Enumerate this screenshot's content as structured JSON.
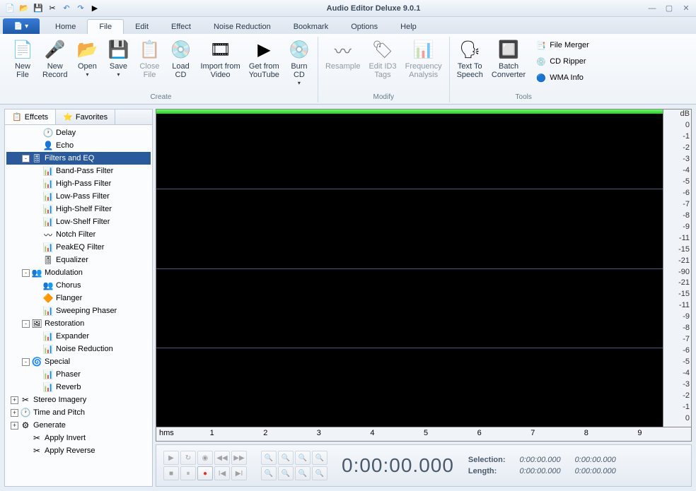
{
  "title": "Audio Editor Deluxe 9.0.1",
  "ribbon_tabs": [
    "Home",
    "File",
    "Edit",
    "Effect",
    "Noise Reduction",
    "Bookmark",
    "Options",
    "Help"
  ],
  "ribbon": {
    "create": {
      "label": "Create",
      "items": [
        {
          "label": "New\nFile",
          "icon": "📄"
        },
        {
          "label": "New\nRecord",
          "icon": "🎤"
        },
        {
          "label": "Open",
          "icon": "📂",
          "drop": true
        },
        {
          "label": "Save",
          "icon": "💾",
          "drop": true
        },
        {
          "label": "Close\nFile",
          "icon": "📋",
          "disabled": true
        },
        {
          "label": "Load\nCD",
          "icon": "💿"
        },
        {
          "label": "Import from\nVideo",
          "icon": "🎞"
        },
        {
          "label": "Get from\nYouTube",
          "icon": "▶"
        },
        {
          "label": "Burn\nCD",
          "icon": "💿",
          "drop": true
        }
      ]
    },
    "modify": {
      "label": "Modify",
      "items": [
        {
          "label": "Resample",
          "icon": "〰",
          "disabled": true
        },
        {
          "label": "Edit ID3\nTags",
          "icon": "🏷",
          "disabled": true
        },
        {
          "label": "Frequency\nAnalysis",
          "icon": "📊",
          "disabled": true
        }
      ]
    },
    "tools": {
      "label": "Tools",
      "items": [
        {
          "label": "Text To\nSpeech",
          "icon": "🗣"
        },
        {
          "label": "Batch\nConverter",
          "icon": "🔲"
        }
      ],
      "side": [
        {
          "label": "File Merger",
          "icon": "📑"
        },
        {
          "label": "CD Ripper",
          "icon": "💿"
        },
        {
          "label": "WMA Info",
          "icon": "🔵"
        }
      ]
    }
  },
  "side_tabs": {
    "effects": "Effcets",
    "favorites": "Favorites"
  },
  "tree": [
    {
      "indent": 2,
      "icon": "🕐",
      "label": "Delay"
    },
    {
      "indent": 2,
      "icon": "👤",
      "label": "Echo"
    },
    {
      "indent": 1,
      "toggle": "-",
      "icon": "🎚",
      "label": "Filters and EQ",
      "selected": true
    },
    {
      "indent": 2,
      "icon": "📊",
      "label": "Band-Pass Filter"
    },
    {
      "indent": 2,
      "icon": "📊",
      "label": "High-Pass Filter"
    },
    {
      "indent": 2,
      "icon": "📊",
      "label": "Low-Pass Filter"
    },
    {
      "indent": 2,
      "icon": "📊",
      "label": "High-Shelf Filter"
    },
    {
      "indent": 2,
      "icon": "📊",
      "label": "Low-Shelf Filter"
    },
    {
      "indent": 2,
      "icon": "〰",
      "label": "Notch Filter"
    },
    {
      "indent": 2,
      "icon": "📊",
      "label": "PeakEQ Filter"
    },
    {
      "indent": 2,
      "icon": "🎚",
      "label": "Equalizer"
    },
    {
      "indent": 1,
      "toggle": "-",
      "icon": "👥",
      "label": "Modulation"
    },
    {
      "indent": 2,
      "icon": "👥",
      "label": "Chorus"
    },
    {
      "indent": 2,
      "icon": "🔶",
      "label": "Flanger"
    },
    {
      "indent": 2,
      "icon": "📊",
      "label": "Sweeping Phaser"
    },
    {
      "indent": 1,
      "toggle": "-",
      "icon": "🖼",
      "label": "Restoration"
    },
    {
      "indent": 2,
      "icon": "📊",
      "label": "Expander"
    },
    {
      "indent": 2,
      "icon": "📊",
      "label": "Noise Reduction"
    },
    {
      "indent": 1,
      "toggle": "-",
      "icon": "🌀",
      "label": "Special"
    },
    {
      "indent": 2,
      "icon": "📊",
      "label": "Phaser"
    },
    {
      "indent": 2,
      "icon": "📊",
      "label": "Reverb"
    },
    {
      "indent": 0,
      "toggle": "+",
      "icon": "✂",
      "label": "Stereo Imagery"
    },
    {
      "indent": 0,
      "toggle": "+",
      "icon": "🕐",
      "label": "Time and Pitch"
    },
    {
      "indent": 0,
      "toggle": "+",
      "icon": "⚙",
      "label": "Generate"
    },
    {
      "indent": 1,
      "icon": "✂",
      "label": "Apply Invert"
    },
    {
      "indent": 1,
      "icon": "✂",
      "label": "Apply Reverse"
    }
  ],
  "db_scale": [
    "dB",
    "0",
    "-1",
    "-2",
    "-3",
    "-4",
    "-5",
    "-6",
    "-7",
    "-8",
    "-9",
    "-11",
    "-15",
    "-21",
    "-90",
    "-21",
    "-15",
    "-11",
    "-9",
    "-8",
    "-7",
    "-6",
    "-5",
    "-4",
    "-3",
    "-2",
    "-1",
    "0"
  ],
  "timeline": {
    "unit": "hms",
    "ticks": [
      "1",
      "2",
      "3",
      "4",
      "5",
      "6",
      "7",
      "8",
      "9"
    ]
  },
  "timecode": "0:00:00.000",
  "selection": {
    "sel_label": "Selection:",
    "sel_start": "0:00:00.000",
    "sel_end": "0:00:00.000",
    "len_label": "Length:",
    "len_start": "0:00:00.000",
    "len_end": "0:00:00.000"
  }
}
